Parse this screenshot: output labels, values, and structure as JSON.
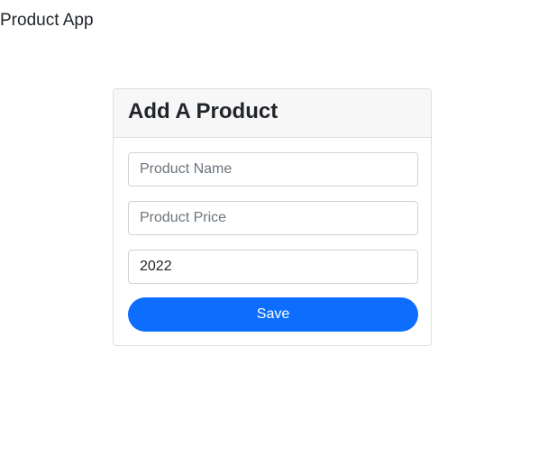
{
  "app": {
    "title": "Product App"
  },
  "form": {
    "heading": "Add A Product",
    "product_name": {
      "placeholder": "Product Name",
      "value": ""
    },
    "product_price": {
      "placeholder": "Product Price",
      "value": ""
    },
    "year": {
      "value": "2022"
    },
    "save_label": "Save"
  },
  "colors": {
    "primary": "#0d6efd",
    "header_bg": "#f7f7f7",
    "border": "#dfdfdf"
  }
}
